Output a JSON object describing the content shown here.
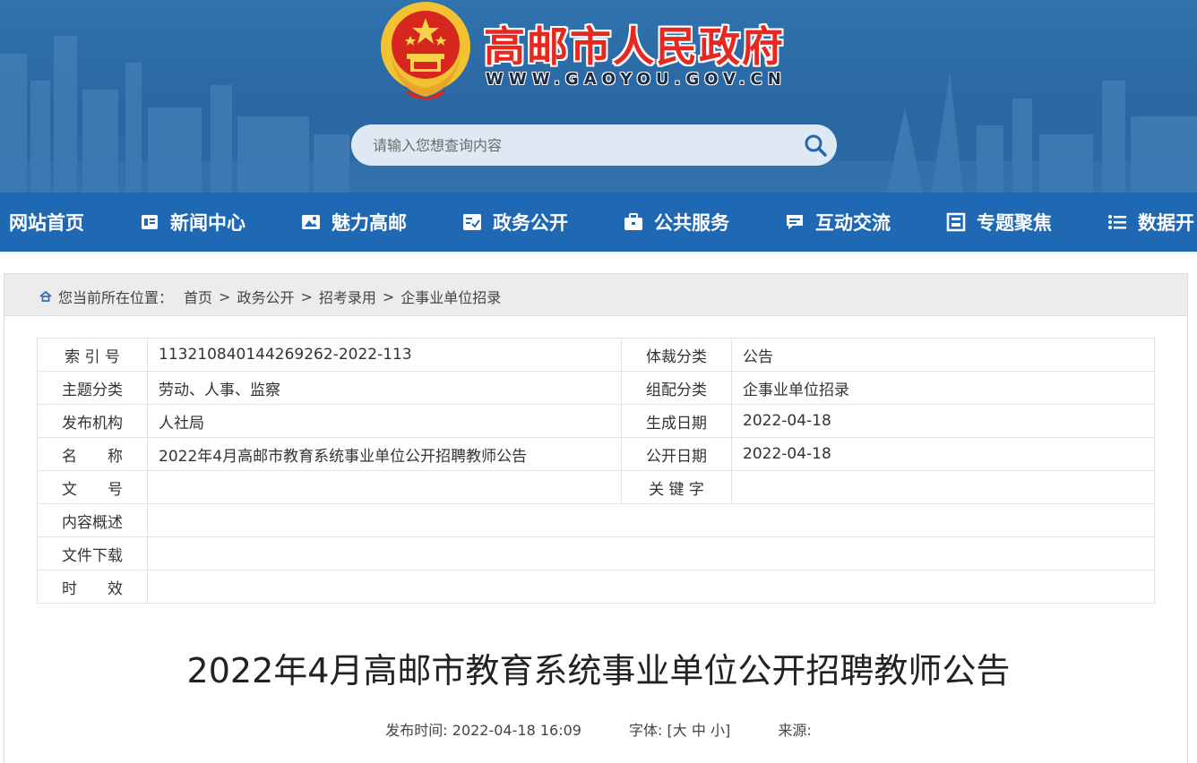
{
  "header": {
    "site_title": "高邮市人民政府",
    "site_url": "WWW.GAOYOU.GOV.CN",
    "search_placeholder": "请输入您想查询内容"
  },
  "nav": {
    "items": [
      {
        "label": "网站首页",
        "icon": "none"
      },
      {
        "label": "新闻中心",
        "icon": "newspaper-icon"
      },
      {
        "label": "魅力高邮",
        "icon": "image-icon"
      },
      {
        "label": "政务公开",
        "icon": "checklist-icon"
      },
      {
        "label": "公共服务",
        "icon": "briefcase-icon"
      },
      {
        "label": "互动交流",
        "icon": "chat-icon"
      },
      {
        "label": "专题聚焦",
        "icon": "building-icon"
      },
      {
        "label": "数据开",
        "icon": "list-icon"
      }
    ]
  },
  "breadcrumb": {
    "prefix": "您当前所在位置：",
    "items": [
      "首页",
      "政务公开",
      "招考录用",
      "企事业单位招录"
    ],
    "separator": ">"
  },
  "info": {
    "rows": [
      {
        "label": "索 引 号",
        "value": "113210840144269262-2022-113",
        "label2": "体裁分类",
        "value2": "公告"
      },
      {
        "label": "主题分类",
        "value": "劳动、人事、监察",
        "label2": "组配分类",
        "value2": "企事业单位招录"
      },
      {
        "label": "发布机构",
        "value": "人社局",
        "label2": "生成日期",
        "value2": "2022-04-18"
      },
      {
        "label": "名　　称",
        "value": "2022年4月高邮市教育系统事业单位公开招聘教师公告",
        "label2": "公开日期",
        "value2": "2022-04-18"
      },
      {
        "label": "文　　号",
        "value": "",
        "label2": "关 键 字",
        "value2": ""
      }
    ],
    "wide_rows": [
      {
        "label": "内容概述",
        "value": ""
      },
      {
        "label": "文件下载",
        "value": ""
      },
      {
        "label": "时　　效",
        "value": ""
      }
    ]
  },
  "article": {
    "title": "2022年4月高邮市教育系统事业单位公开招聘教师公告",
    "publish_label": "发布时间: 2022-04-18 16:09",
    "font_label": "字体:",
    "font_options": "[大 中 小]",
    "source_label": "来源:"
  },
  "colors": {
    "banner": "#2b6aa5",
    "nav": "#1f68b3",
    "title_red": "#e8281f"
  }
}
